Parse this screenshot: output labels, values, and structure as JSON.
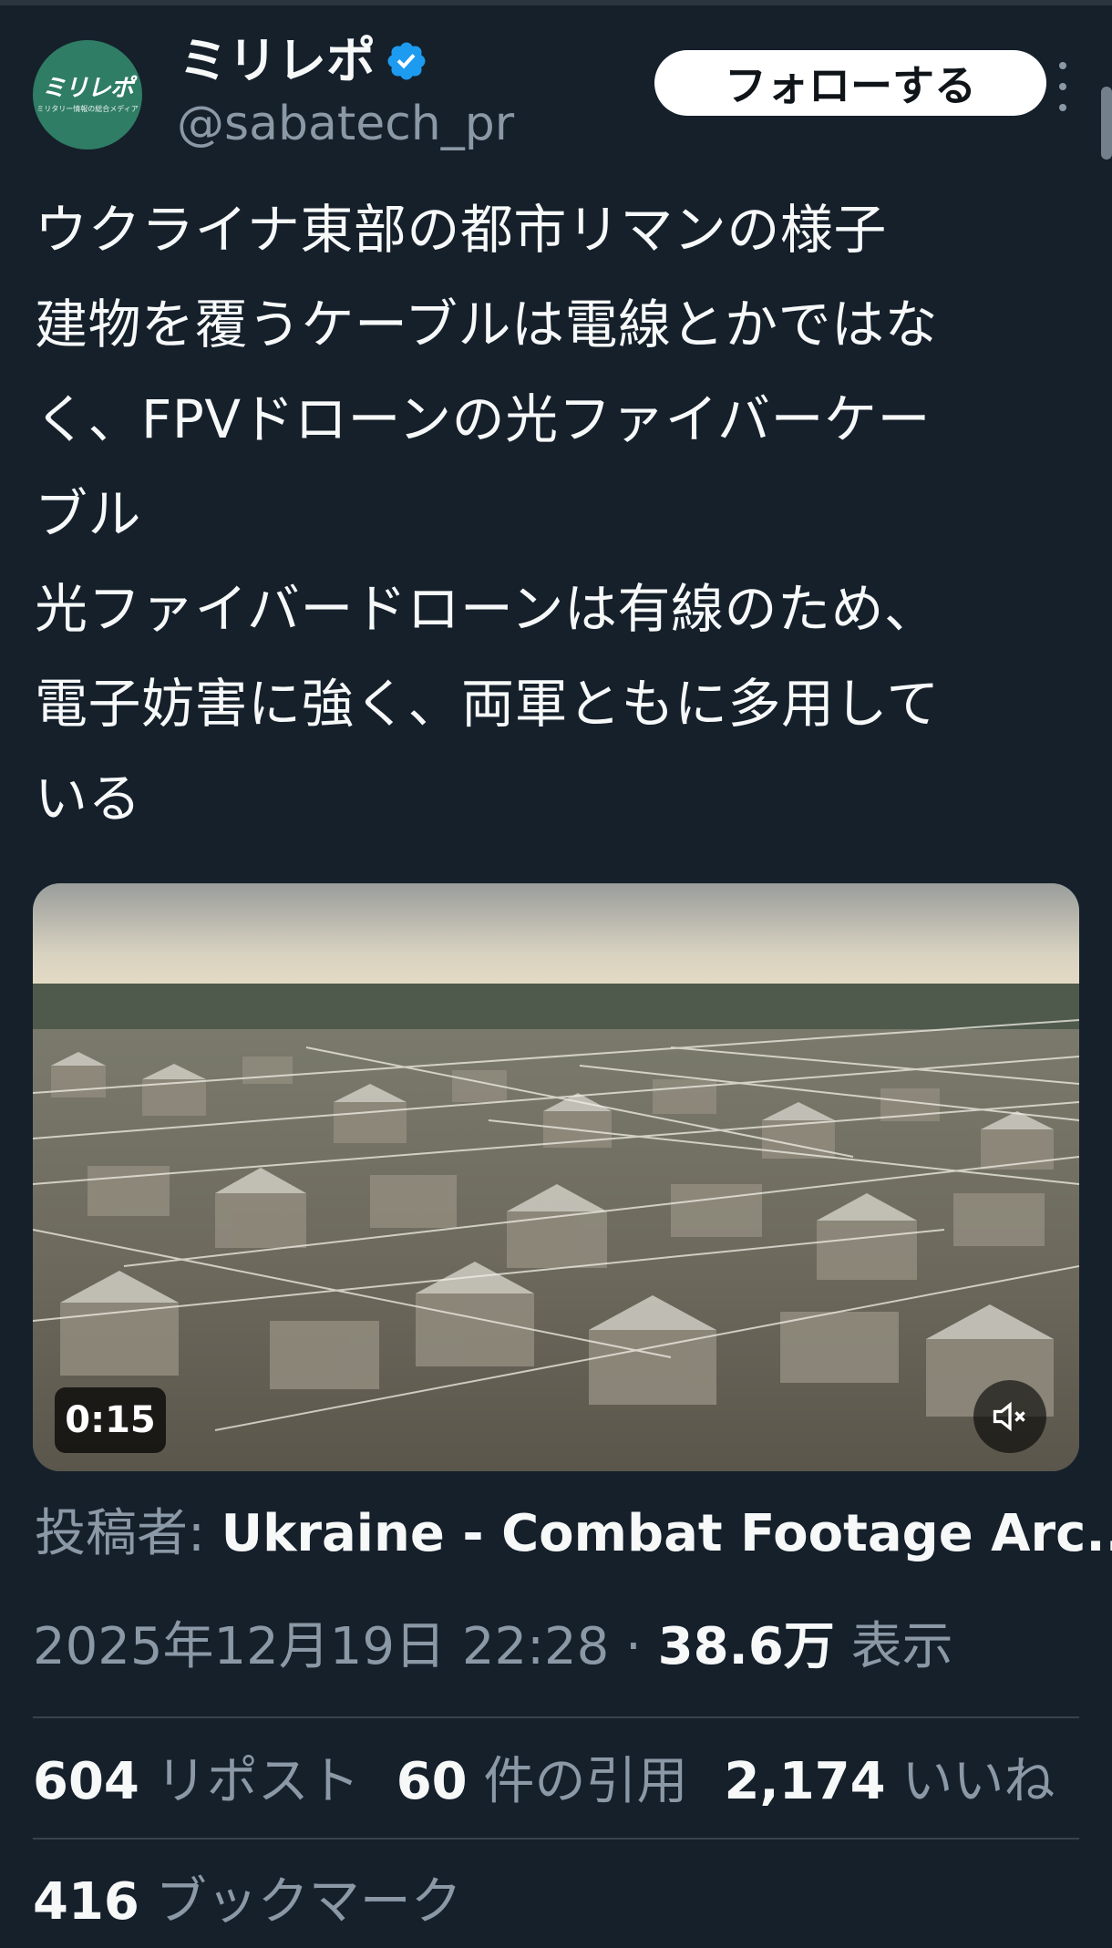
{
  "account": {
    "avatar_logo": "ミリレポ",
    "avatar_tagline": "ミリタリー情報の総合メディア",
    "name": "ミリレポ",
    "handle": "@sabatech_pr",
    "follow_label": "フォローする",
    "verified_color": "#1d9bf0",
    "avatar_color": "#2f7d64"
  },
  "tweet": {
    "text": "ウクライナ東部の都市リマンの様子\n建物を覆うケーブルは電線とかではな\nく、FPVドローンの光ファイバーケー\nブル\n光ファイバードローンは有線のため、\n電子妨害に強く、両軍ともに多用して\nいる"
  },
  "media": {
    "duration": "0:15",
    "mute_icon": "speaker-muted-icon"
  },
  "source": {
    "label": "投稿者: ",
    "value": "Ukraine - Combat Footage Arc..."
  },
  "meta": {
    "datetime": "2025年12月19日 22:28",
    "separator": " · ",
    "views_count": "38.6万",
    "views_label": " 表示"
  },
  "stats": {
    "reposts_count": "604",
    "reposts_label": " リポスト",
    "quotes_count": "60",
    "quotes_label": " 件の引用",
    "likes_count": "2,174",
    "likes_label": " いいね",
    "bookmarks_count": "416",
    "bookmarks_label": " ブックマーク"
  },
  "theme": {
    "background": "#15202b",
    "text": "#f7f9f9",
    "muted_text": "#8b98a5",
    "divider": "#38444d"
  }
}
